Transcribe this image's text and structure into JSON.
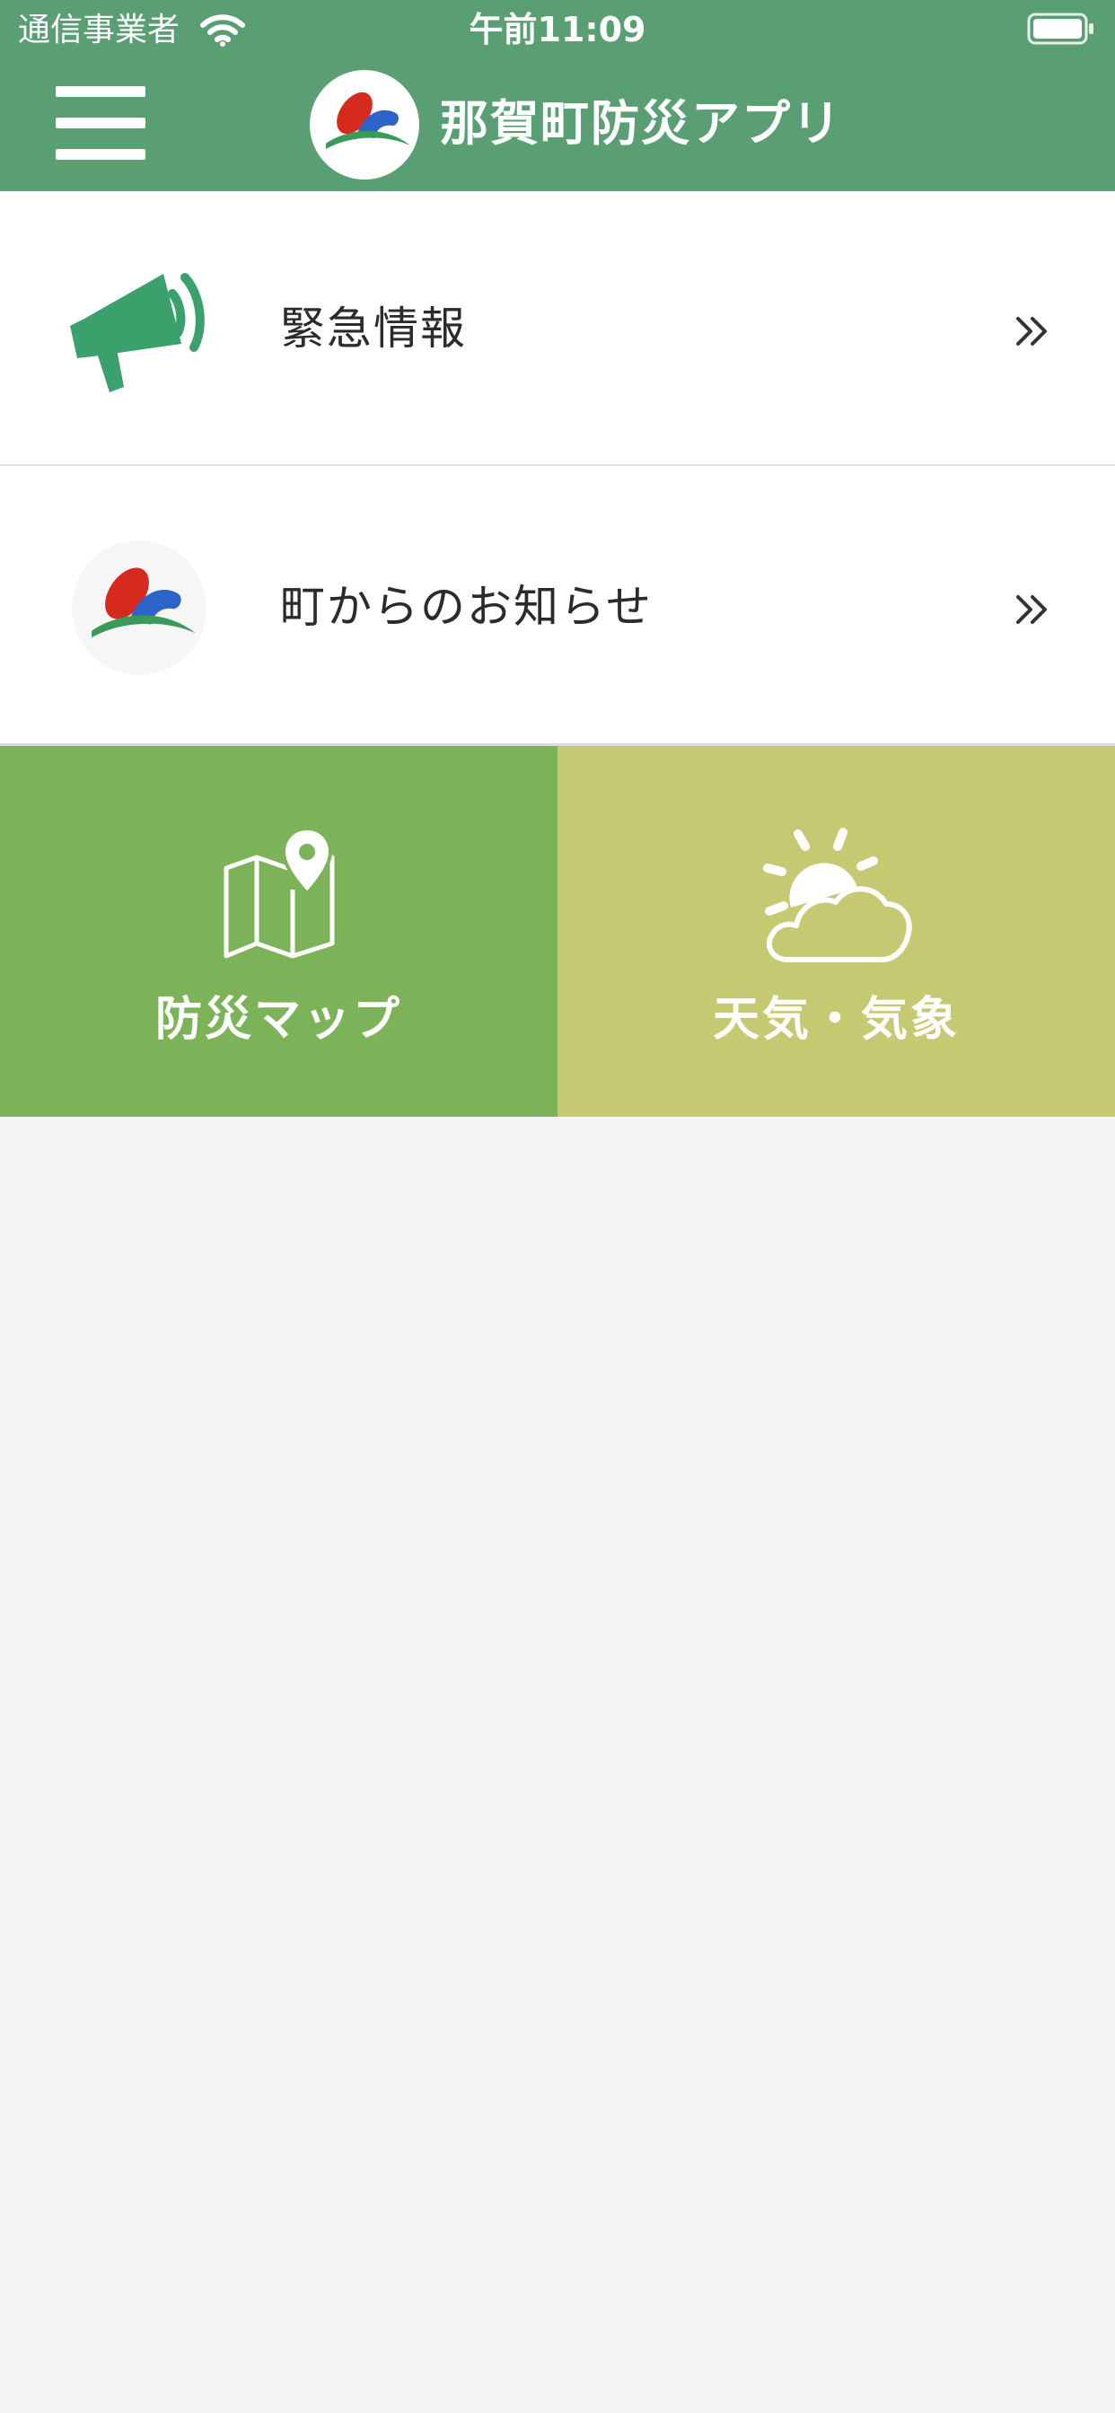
{
  "status_bar": {
    "carrier": "通信事業者",
    "time": "午前11:09",
    "wifi_icon": "wifi-icon",
    "battery_icon": "battery-full-icon"
  },
  "header": {
    "menu_icon": "hamburger-menu-icon",
    "logo_icon": "town-emblem-icon",
    "title": "那賀町防災アプリ",
    "background_color": "#5a9e74"
  },
  "list": [
    {
      "label": "緊急情報",
      "icon": "megaphone-icon",
      "chevron": "double-chevron-right-icon"
    },
    {
      "label": "町からのお知らせ",
      "icon": "town-emblem-icon",
      "chevron": "double-chevron-right-icon"
    }
  ],
  "tiles": [
    {
      "label": "防災マップ",
      "icon": "map-pin-icon",
      "color": "#7db358"
    },
    {
      "label": "天気・気象",
      "icon": "sun-cloud-icon",
      "color": "#c5c971"
    }
  ],
  "colors": {
    "accent_green": "#3aa06c",
    "page_background": "#f4f4f4"
  }
}
